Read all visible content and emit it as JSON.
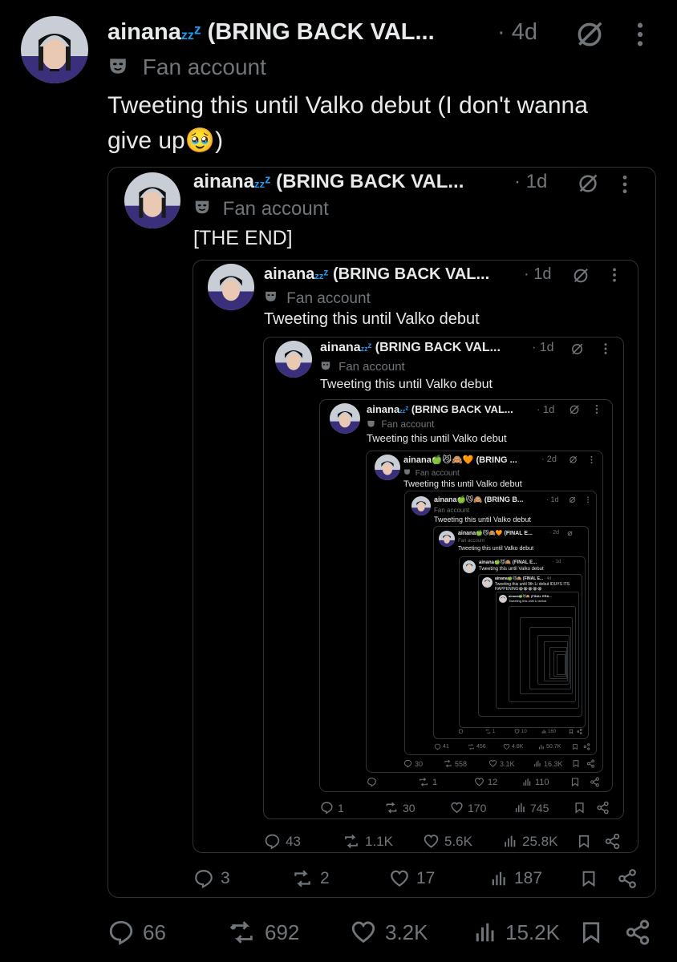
{
  "author": {
    "name_short": "ainana",
    "name_suffix": "(BRING BACK VAL...",
    "badge": "Fan account"
  },
  "main_tweet": {
    "time": "· 4d",
    "text_line1": "Tweeting this until Valko debut (I don't wanna",
    "text_line2": "give up🥹)",
    "replies": "66",
    "reposts": "692",
    "likes": "3.2K",
    "views": "15.2K"
  },
  "q1": {
    "time": "· 1d",
    "text": "[THE END]",
    "replies": "3",
    "reposts": "2",
    "likes": "17",
    "views": "187"
  },
  "q2": {
    "time": "· 1d",
    "text": "Tweeting this until Valko debut",
    "replies": "43",
    "reposts": "1.1K",
    "likes": "5.6K",
    "views": "25.8K"
  },
  "q3": {
    "time": "· 1d",
    "text": "Tweeting this until Valko debut",
    "replies": "1",
    "reposts": "30",
    "likes": "170",
    "views": "745"
  },
  "q4": {
    "time": "· 1d",
    "text": "Tweeting this until Valko debut",
    "replies": "",
    "reposts": "1",
    "likes": "12",
    "views": "110"
  },
  "q5": {
    "name_short": "ainana🍏😼🙈🧡",
    "name_suffix": "(BRING ...",
    "time": "· 2d",
    "text": "Tweeting this until Valko debut",
    "replies": "30",
    "reposts": "558",
    "likes": "3.1K",
    "views": "16.3K"
  },
  "q6": {
    "name_short": "ainana🍏😼🙈",
    "name_suffix": "(BRING B...",
    "time": "· 1d",
    "text": "Tweeting this until Valko debut",
    "replies": "41",
    "reposts": "456",
    "likes": "4.8K",
    "views": "50.7K"
  },
  "q7": {
    "name_short": "ainana🍏😼🙈🧡",
    "name_suffix": "(FINAL E...",
    "time": "· 2d",
    "text": "Tweeting this until Valko debut",
    "replies": "",
    "reposts": "1",
    "likes": "10",
    "views": "160"
  },
  "q8": {
    "name_short": "ainana🍏😼🙈",
    "name_suffix": "(FINAL E...",
    "time": "· 1d",
    "text": "Tweeting this until Valko debut"
  },
  "q9": {
    "name_short": "ainana🍏😼🙈",
    "name_suffix": "(FINAL E...",
    "time": "· 4d",
    "text_line1": "Tweeting this until 9th Li debut IDUYS ITS",
    "text_line2": "HAPPENING😭😭😭😭😭"
  },
  "q10": {
    "name_short": "ainana🍏😼🙈",
    "name_suffix": "(FINAL ERA...",
    "text": "Tweeting this until Li debut"
  }
}
